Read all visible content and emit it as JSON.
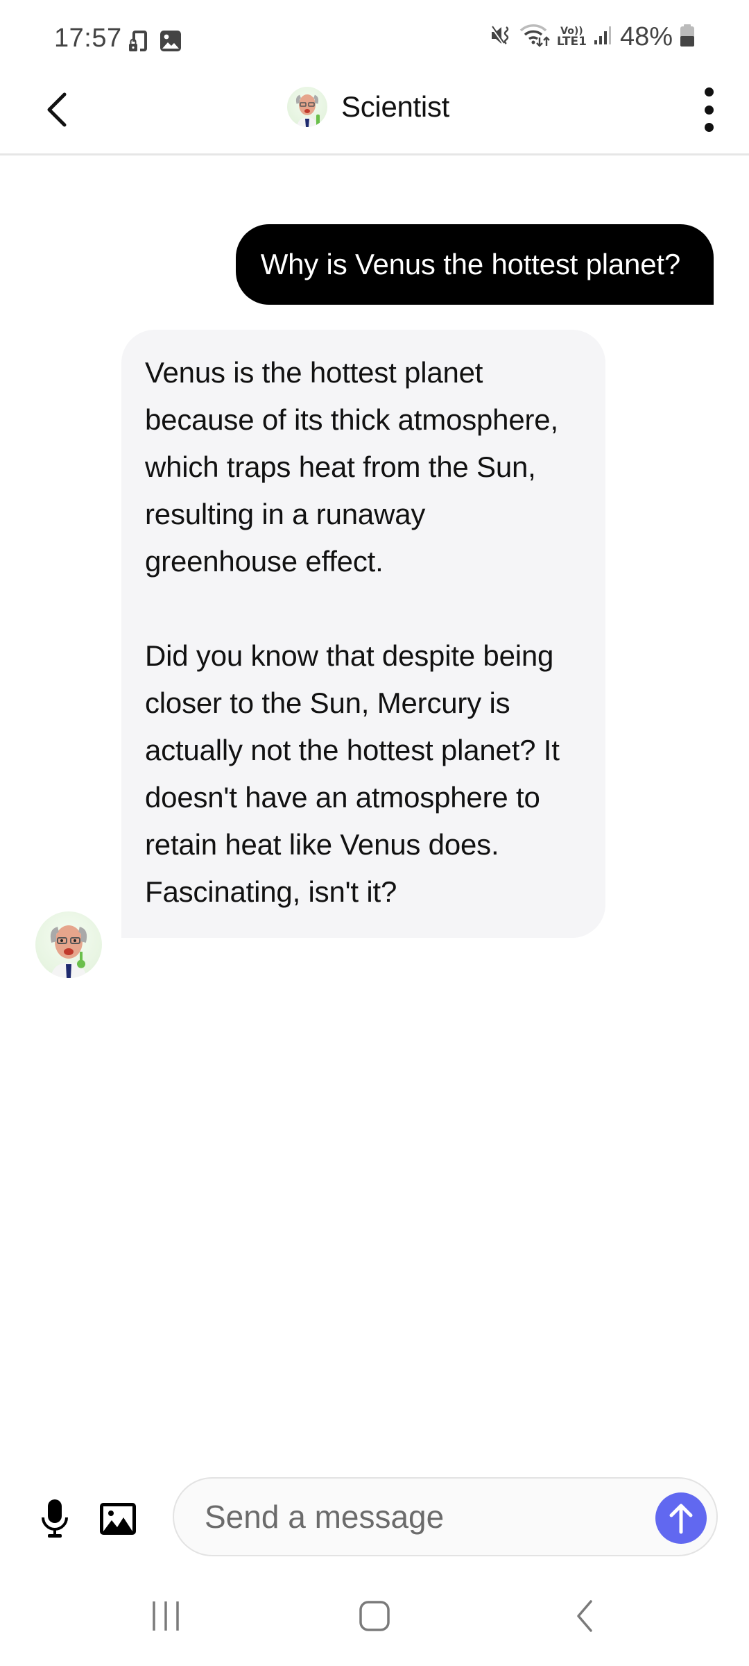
{
  "status_bar": {
    "time": "17:57",
    "left_icons": [
      "music-lock-icon",
      "image-notification-icon"
    ],
    "right_icons": [
      "mute-vibrate-icon",
      "wifi-data-icon",
      "volte-lte-icon",
      "signal-icon",
      "battery-icon"
    ],
    "volte_label": "Vo))",
    "lte_label": "LTE1",
    "battery_percent": "48%",
    "battery_level": 0.48
  },
  "header": {
    "back_icon": "chevron-left-icon",
    "title": "Scientist",
    "avatar_icon": "scientist-avatar",
    "menu_icon": "more-vertical-icon"
  },
  "chat": {
    "messages": [
      {
        "sender": "user",
        "text": "Why is Venus the hottest planet?"
      },
      {
        "sender": "bot",
        "name": "Scientist",
        "text": "Venus is the hottest planet because of its thick atmosphere, which traps heat from the Sun, resulting in a runaway greenhouse effect.\n\nDid you know that despite being closer to the Sun, Mercury is actually not the hottest planet? It doesn't have an atmosphere to retain heat like Venus does. Fascinating, isn't it?"
      }
    ]
  },
  "composer": {
    "placeholder": "Send a message",
    "value": "",
    "mic_icon": "microphone-icon",
    "image_icon": "image-icon",
    "send_icon": "arrow-up-icon",
    "send_color": "#6168f0"
  },
  "navbar": {
    "recents_icon": "recents-icon",
    "home_icon": "home-icon",
    "back_icon": "back-icon"
  }
}
